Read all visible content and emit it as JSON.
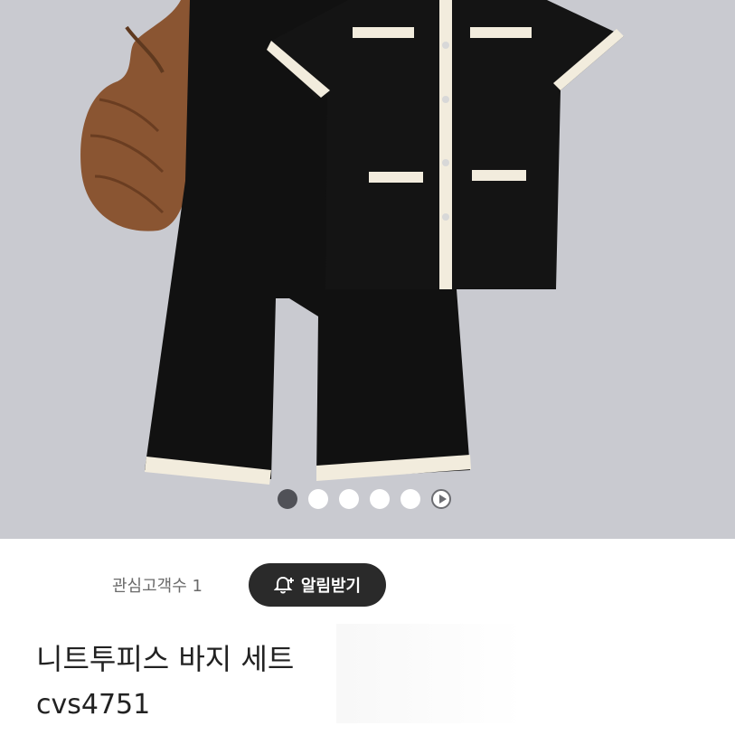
{
  "product": {
    "image_alt": "black knit two-piece set with cream trim and brown bag",
    "carousel": {
      "total_images": 5,
      "current_index": 1,
      "has_play_button": true
    },
    "watchers_label": "관심고객수 1",
    "alarm_button_label": "알림받기",
    "title": "니트투피스 바지 세트",
    "subtitle": "cvs4751"
  },
  "colors": {
    "background": "#c9cad0",
    "garment": "#111111",
    "trim": "#f2ecdd",
    "bag": "#8a5532",
    "button_bg": "#2a2a2a"
  }
}
